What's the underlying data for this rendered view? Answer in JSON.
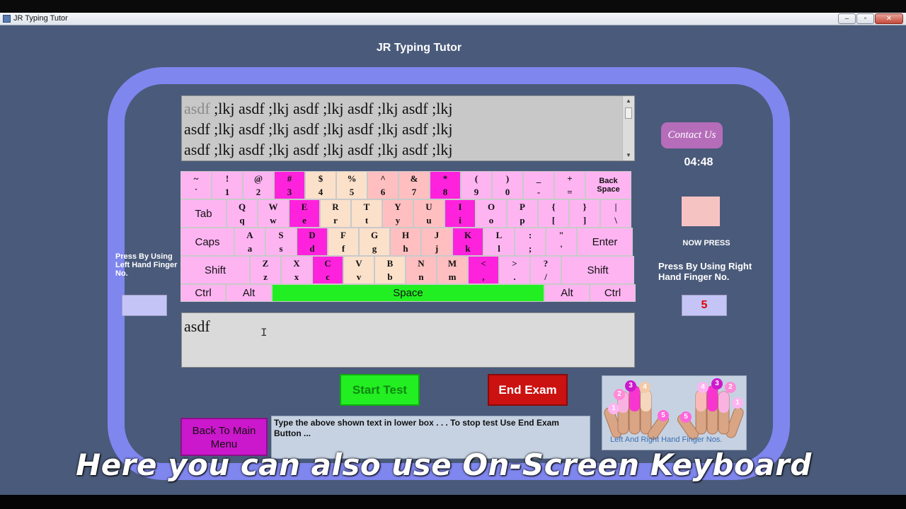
{
  "window": {
    "title": "JR Typing Tutor",
    "controls": [
      "minimize",
      "maximize",
      "close"
    ]
  },
  "app": {
    "title": "JR Typing Tutor"
  },
  "target_text": {
    "lines": [
      {
        "done": "asdf",
        "rest": " ;lkj asdf ;lkj asdf ;lkj asdf ;lkj asdf ;lkj"
      },
      {
        "done": "",
        "rest": "asdf ;lkj asdf ;lkj asdf ;lkj asdf ;lkj asdf ;lkj"
      },
      {
        "done": "",
        "rest": "asdf ;lkj asdf ;lkj asdf ;lkj asdf ;lkj asdf ;lkj"
      }
    ]
  },
  "keyboard": {
    "colors": {
      "m": "#ff22dd",
      "l": "#ffb4f2",
      "p": "#ffbfc0",
      "b": "#fbe0ca",
      "g": "#22ef22"
    },
    "rows": [
      [
        {
          "top": "~",
          "bottom": "`",
          "color": "l"
        },
        {
          "top": "!",
          "bottom": "1",
          "color": "l"
        },
        {
          "top": "@",
          "bottom": "2",
          "color": "l"
        },
        {
          "top": "#",
          "bottom": "3",
          "color": "m"
        },
        {
          "top": "$",
          "bottom": "4",
          "color": "b"
        },
        {
          "top": "%",
          "bottom": "5",
          "color": "b"
        },
        {
          "top": "^",
          "bottom": "6",
          "color": "p"
        },
        {
          "top": "&",
          "bottom": "7",
          "color": "p"
        },
        {
          "top": "*",
          "bottom": "8",
          "color": "m"
        },
        {
          "top": "(",
          "bottom": "9",
          "color": "l"
        },
        {
          "top": ")",
          "bottom": "0",
          "color": "l"
        },
        {
          "top": "_",
          "bottom": "-",
          "color": "l"
        },
        {
          "top": "+",
          "bottom": "=",
          "color": "l"
        },
        {
          "label": "Back Space",
          "color": "l",
          "wide": true,
          "small": true
        }
      ],
      [
        {
          "label": "Tab",
          "color": "l",
          "wide": true
        },
        {
          "top": "Q",
          "bottom": "q",
          "color": "l"
        },
        {
          "top": "W",
          "bottom": "w",
          "color": "l"
        },
        {
          "top": "E",
          "bottom": "e",
          "color": "m"
        },
        {
          "top": "R",
          "bottom": "r",
          "color": "b"
        },
        {
          "top": "T",
          "bottom": "t",
          "color": "b"
        },
        {
          "top": "Y",
          "bottom": "y",
          "color": "p"
        },
        {
          "top": "U",
          "bottom": "u",
          "color": "p"
        },
        {
          "top": "I",
          "bottom": "i",
          "color": "m"
        },
        {
          "top": "O",
          "bottom": "o",
          "color": "l"
        },
        {
          "top": "P",
          "bottom": "p",
          "color": "l"
        },
        {
          "top": "{",
          "bottom": "[",
          "color": "l"
        },
        {
          "top": "}",
          "bottom": "]",
          "color": "l"
        },
        {
          "top": "|",
          "bottom": "\\",
          "color": "l"
        }
      ],
      [
        {
          "label": "Caps",
          "color": "l",
          "wide": true
        },
        {
          "top": "A",
          "bottom": "a",
          "color": "l"
        },
        {
          "top": "S",
          "bottom": "s",
          "color": "l"
        },
        {
          "top": "D",
          "bottom": "d",
          "color": "m"
        },
        {
          "top": "F",
          "bottom": "f",
          "color": "b"
        },
        {
          "top": "G",
          "bottom": "g",
          "color": "b"
        },
        {
          "top": "H",
          "bottom": "h",
          "color": "p"
        },
        {
          "top": "J",
          "bottom": "j",
          "color": "p"
        },
        {
          "top": "K",
          "bottom": "k",
          "color": "m"
        },
        {
          "top": "L",
          "bottom": "l",
          "color": "l"
        },
        {
          "top": ":",
          "bottom": ";",
          "color": "l"
        },
        {
          "top": "\"",
          "bottom": "'",
          "color": "l"
        },
        {
          "label": "Enter",
          "color": "l",
          "wide": true
        }
      ],
      [
        {
          "label": "Shift",
          "color": "l",
          "wide": true
        },
        {
          "top": "Z",
          "bottom": "z",
          "color": "l"
        },
        {
          "top": "X",
          "bottom": "x",
          "color": "l"
        },
        {
          "top": "C",
          "bottom": "c",
          "color": "m"
        },
        {
          "top": "V",
          "bottom": "v",
          "color": "b"
        },
        {
          "top": "B",
          "bottom": "b",
          "color": "b"
        },
        {
          "top": "N",
          "bottom": "n",
          "color": "p"
        },
        {
          "top": "M",
          "bottom": "m",
          "color": "p"
        },
        {
          "top": "<",
          "bottom": ",",
          "color": "m"
        },
        {
          "top": ">",
          "bottom": ".",
          "color": "l"
        },
        {
          "top": "?",
          "bottom": "/",
          "color": "l"
        },
        {
          "label": "Shift",
          "color": "l",
          "wide": true
        }
      ],
      [
        {
          "label": "Ctrl",
          "color": "l",
          "wide": true
        },
        {
          "label": "Alt",
          "color": "l",
          "wide": true
        },
        {
          "label": "Space",
          "color": "g",
          "wide": true
        },
        {
          "label": "Alt",
          "color": "l",
          "wide": true
        },
        {
          "label": "Ctrl",
          "color": "l",
          "wide": true
        }
      ]
    ]
  },
  "side": {
    "contact_label": "Contact Us",
    "timer": "04:48",
    "now_press_label": "NOW PRESS",
    "now_press_key": "",
    "right_hand_label": "Press By Using Right Hand  Finger No.",
    "right_finger": "5",
    "left_hand_label": "Press By Using Left Hand Finger No.",
    "left_finger": ""
  },
  "typed_text": "asdf",
  "buttons": {
    "start": "Start Test",
    "end": "End Exam",
    "back": "Back To Main Menu"
  },
  "instructions": "Type the above shown text in lower box . . . To stop test Use End Exam Button ...",
  "hands_caption": "Left And Right Hand Finger Nos.",
  "finger_numbers_left": [
    "1",
    "2",
    "3",
    "4",
    "5"
  ],
  "finger_numbers_right": [
    "4",
    "3",
    "2",
    "1",
    "5"
  ],
  "subtitle": "Here you can also use On-Screen Keyboard"
}
